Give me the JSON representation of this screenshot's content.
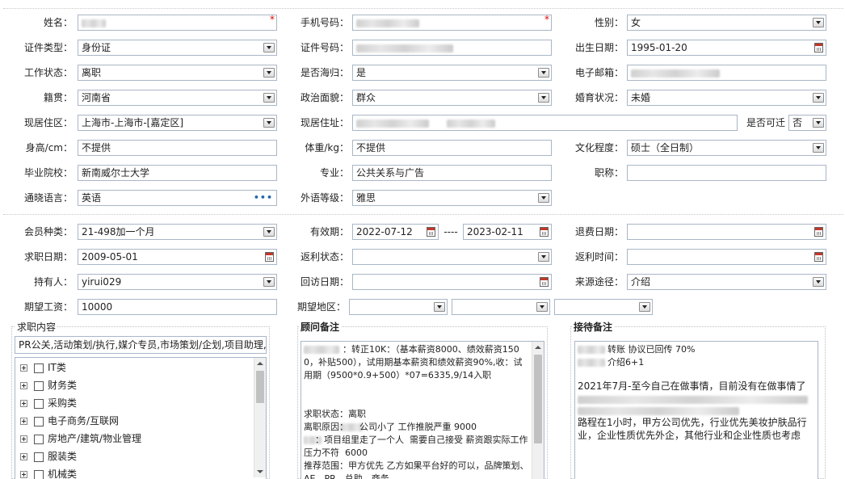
{
  "basic": {
    "name_label": "姓名：",
    "phone_label": "手机号码：",
    "gender_label": "性别：",
    "gender_value": "女",
    "idtype_label": "证件类型：",
    "idtype_value": "身份证",
    "idno_label": "证件号码：",
    "birth_label": "出生日期：",
    "birth_value": "1995-01-20",
    "workstatus_label": "工作状态：",
    "workstatus_value": "离职",
    "returnee_label": "是否海归：",
    "returnee_value": "是",
    "email_label": "电子邮箱：",
    "native_label": "籍贯：",
    "native_value": "河南省",
    "political_label": "政治面貌：",
    "political_value": "群众",
    "marital_label": "婚育状况：",
    "marital_value": "未婚",
    "residence_label": "现居住区：",
    "residence_value": "上海市-上海市-[嘉定区]",
    "address_label": "现居住址：",
    "relocate_label": "是否可迁",
    "relocate_value": "否",
    "height_label": "身高/cm：",
    "height_value": "不提供",
    "weight_label": "体重/kg：",
    "weight_value": "不提供",
    "education_label": "文化程度：",
    "education_value": "硕士（全日制）",
    "school_label": "毕业院校：",
    "school_value": "新南威尔士大学",
    "major_label": "专业：",
    "major_value": "公共关系与广告",
    "title_label": "职称：",
    "language_label": "通晓语言：",
    "language_value": "英语",
    "langlevel_label": "外语等级：",
    "langlevel_value": "雅思"
  },
  "membership": {
    "type_label": "会员种类：",
    "type_value": "21-498加一个月",
    "valid_label": "有效期：",
    "valid_from": "2022-07-12",
    "valid_sep": "----",
    "valid_to": "2023-02-11",
    "refund_label": "退费日期：",
    "jobdate_label": "求职日期：",
    "jobdate_value": "2009-05-01",
    "rebate_status_label": "返利状态：",
    "rebate_time_label": "返利时间：",
    "holder_label": "持有人：",
    "holder_value": "yirui029",
    "revisit_label": "回访日期：",
    "source_label": "来源途径：",
    "source_value": "介绍",
    "salary_label": "期望工资：",
    "salary_value": "10000",
    "region_label": "期望地区："
  },
  "job_content": {
    "title": "求职内容",
    "summary": "PR公关,活动策划/执行,媒介专员,市场策划/企划,项目助理,",
    "tree": [
      {
        "label": "IT类"
      },
      {
        "label": "财务类"
      },
      {
        "label": "采购类"
      },
      {
        "label": "电子商务/互联网"
      },
      {
        "label": "房地产/建筑/物业管理"
      },
      {
        "label": "服装类"
      },
      {
        "label": "机械类"
      }
    ]
  },
  "advisor_notes": {
    "title": "顾问备注",
    "text": "：转正10K：（基本薪资8000、绩效薪资1500，补贴500），试用期基本薪资和绩效薪资90%,收：试用期（9500*0.9+500）*07=6335,9/14入职\n\n\n求职状态：离职\n离职原因：    公司小了 工作推脱严重 9000\n    ：项目组里走了一个人  需要自己接受 薪资跟实际工作压力不符  6000\n推荐范围：甲方优先 乙方如果平台好的可以，品牌策划、AE、PR、总助、商务"
  },
  "reception_notes": {
    "title": "接待备注",
    "line1": "转账  协议已回传   70%",
    "line2": "介绍6+1",
    "line3": "2021年7月-至今自己在做事情，目前没有在做事情了",
    "line4": "路程在1小时，甲方公司优先，行业优先美妆护肤品行业，企业性质优先外企，其他行业和企业性质也考虑"
  }
}
